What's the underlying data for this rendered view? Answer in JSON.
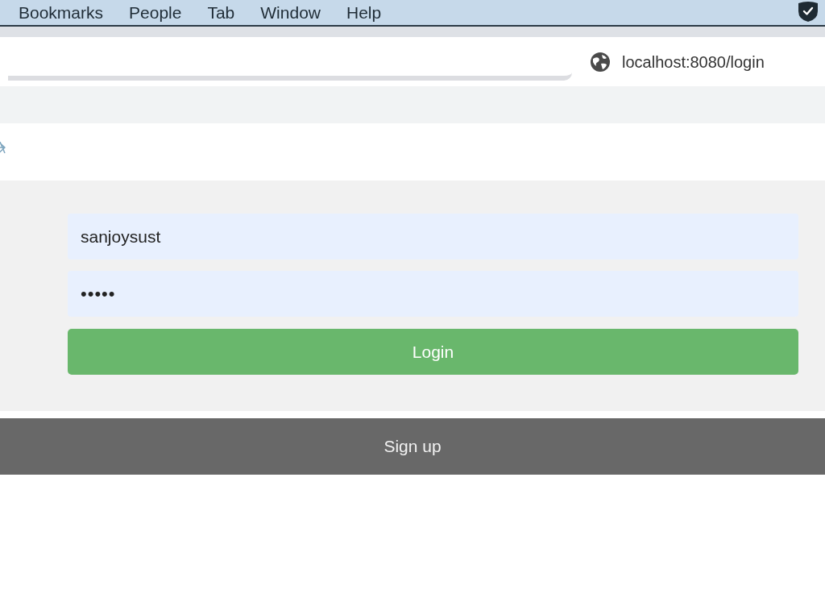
{
  "menu_bar": {
    "items": [
      "Bookmarks",
      "People",
      "Tab",
      "Window",
      "Help"
    ]
  },
  "address_bar": {
    "url": "localhost:8080/login"
  },
  "login_form": {
    "username": {
      "value": "sanjoysust"
    },
    "password": {
      "value": "•••••"
    },
    "submit_button": "Login"
  },
  "signup_bar": {
    "label": "Sign up"
  }
}
